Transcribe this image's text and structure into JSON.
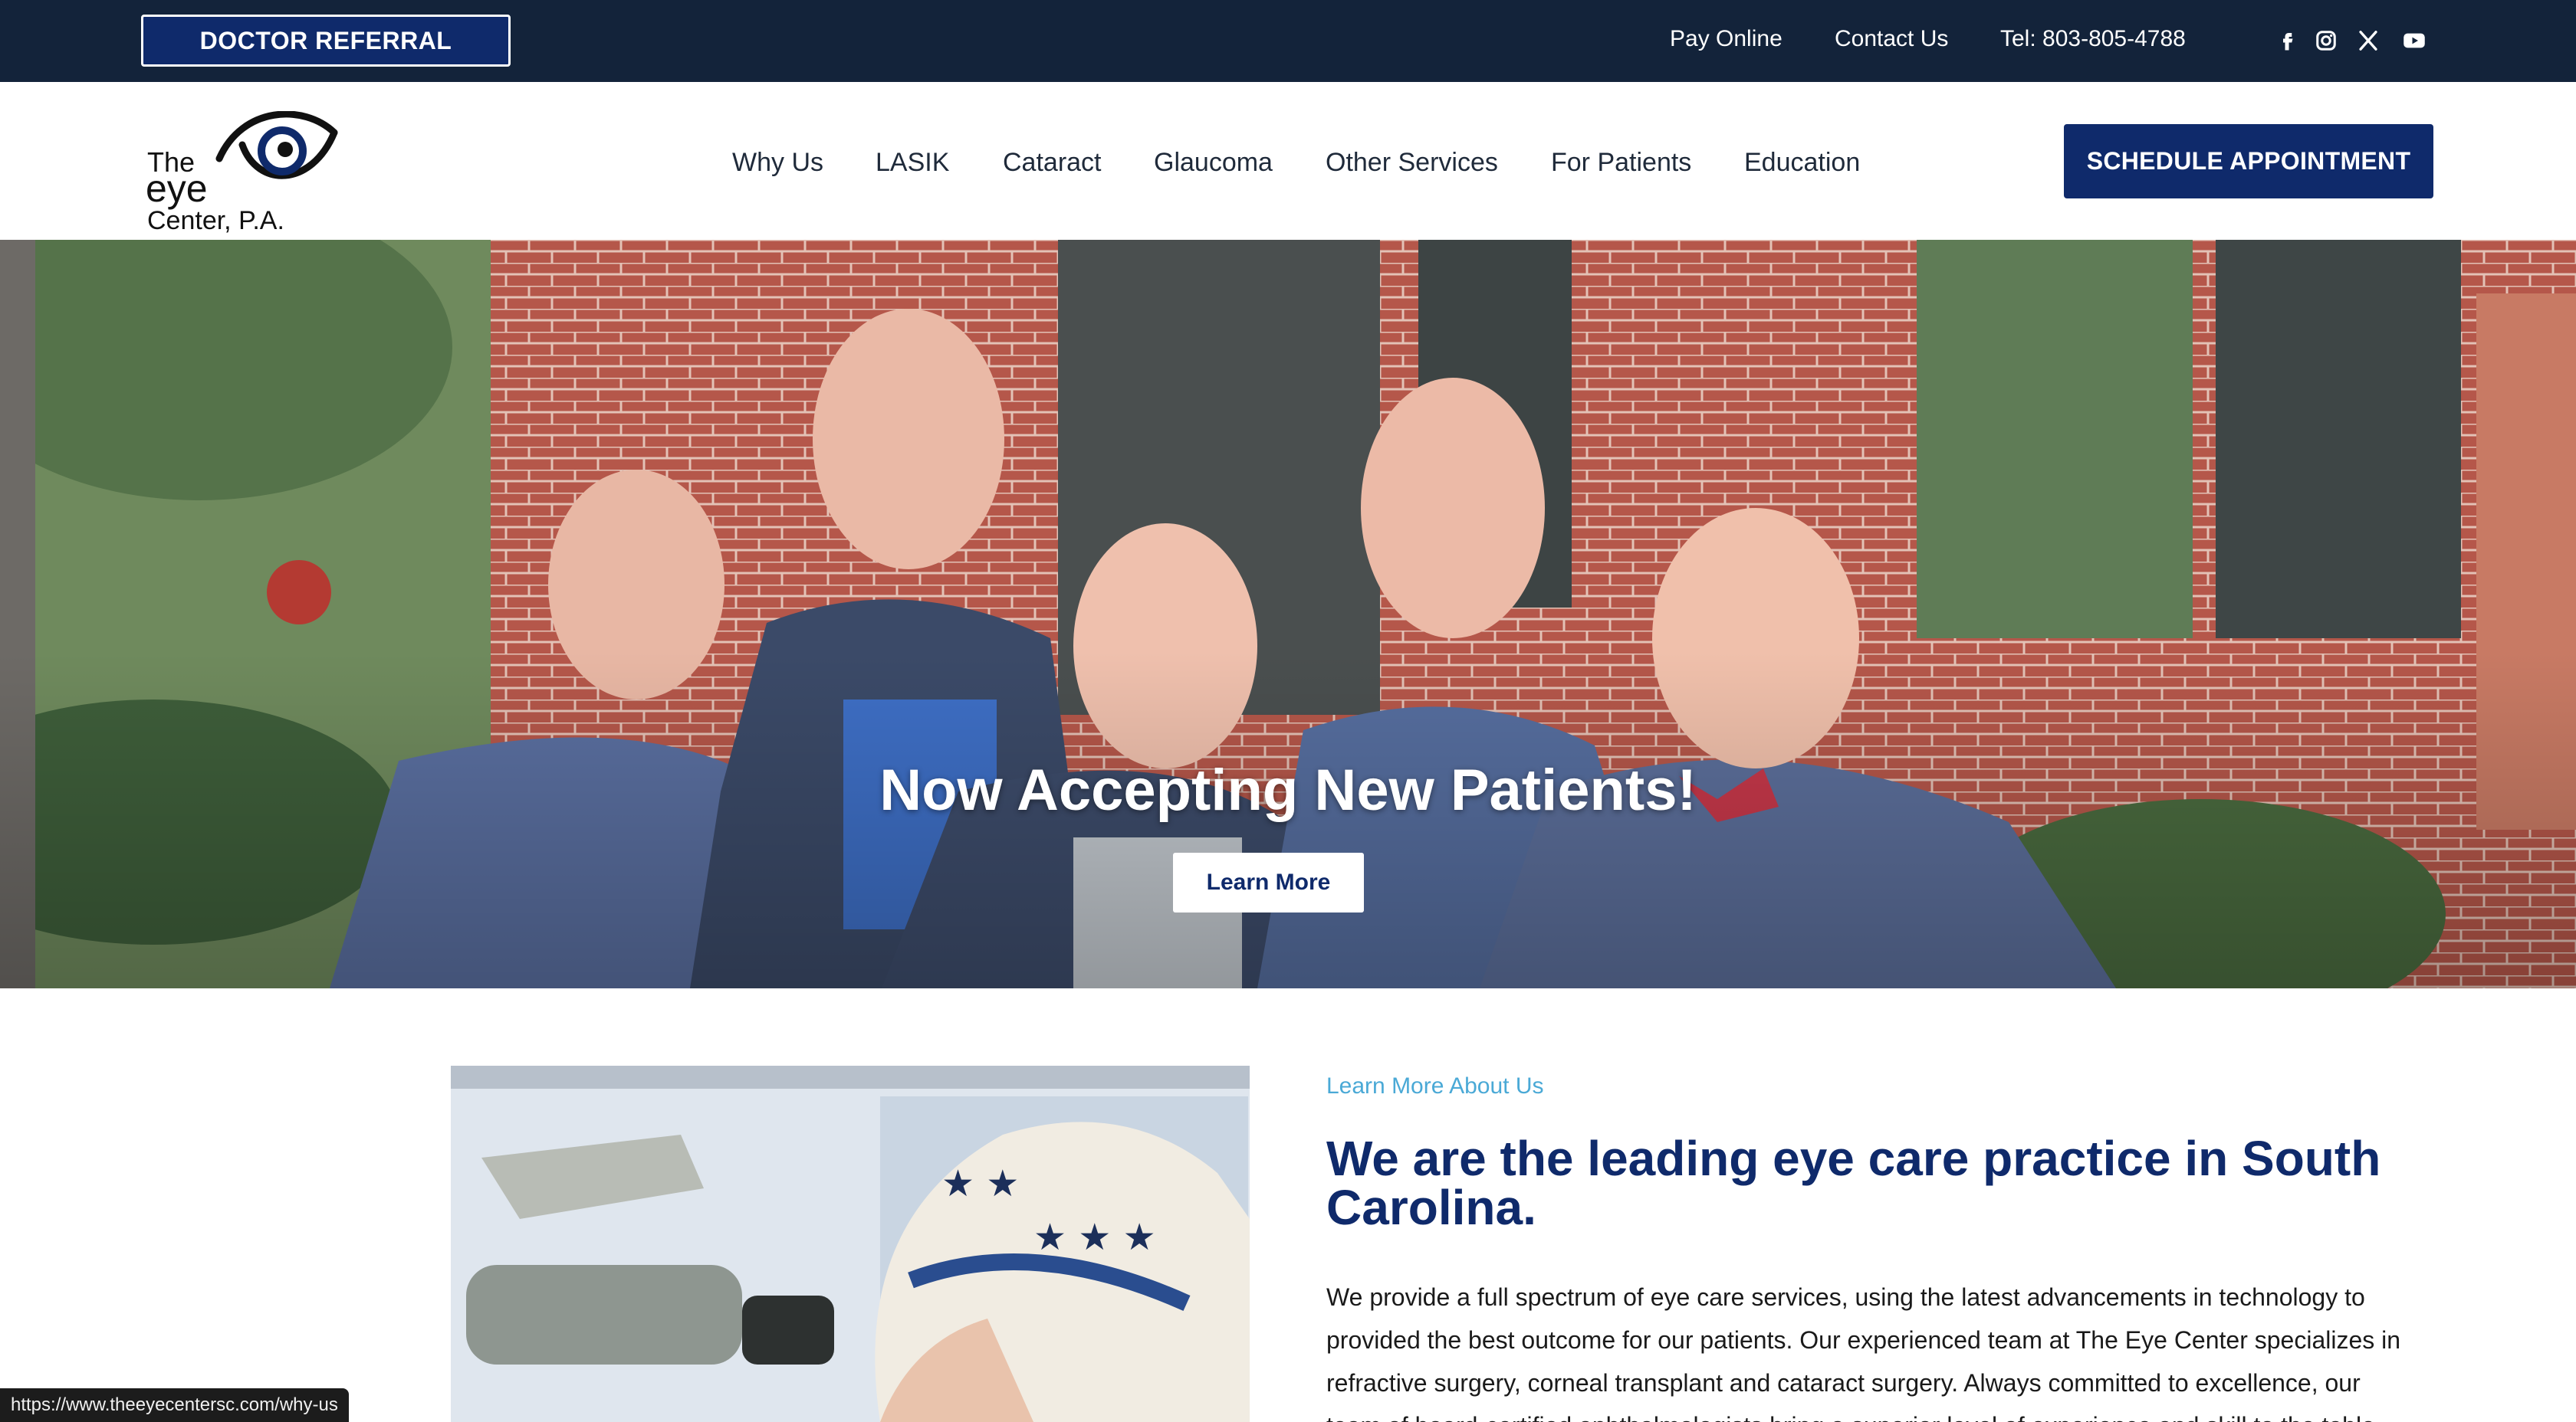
{
  "topbar": {
    "referral_label": "DOCTOR REFERRAL",
    "pay_online": "Pay Online",
    "contact_us": "Contact Us",
    "phone": "Tel: 803-805-4788",
    "social_icons": [
      "facebook-icon",
      "instagram-icon",
      "x-icon",
      "youtube-icon"
    ]
  },
  "logo": {
    "line1": "The",
    "line2": "eye",
    "line3": "Center, P.A."
  },
  "nav": {
    "items": [
      "Why Us",
      "LASIK",
      "Cataract",
      "Glaucoma",
      "Other Services",
      "For Patients",
      "Education"
    ],
    "schedule_label": "SCHEDULE APPOINTMENT"
  },
  "hero": {
    "title": "Now Accepting New Patients!",
    "button_label": "Learn More"
  },
  "about": {
    "eyebrow": "Learn More About Us",
    "heading": "We are the leading eye care practice in South Carolina.",
    "paragraph": "We provide a full spectrum of eye care services, using the latest advancements in technology to provided the best outcome for our patients. Our experienced team at The Eye Center specializes in refractive surgery, corneal transplant and cataract surgery. Always committed to excellence, our team of board-certified ophthalmologists bring a superior level of experience and skill to the table."
  },
  "status": {
    "url": "https://www.theeyecentersc.com/why-us"
  },
  "colors": {
    "navy": "#0f2a6b",
    "topbar": "#13233a",
    "accent_blue": "#4aa9d6"
  }
}
